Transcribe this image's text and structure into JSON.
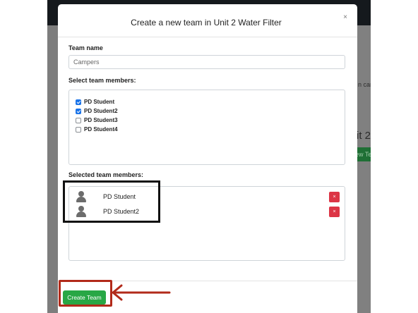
{
  "background": {
    "cards_text": "n card",
    "heading_text": "it 2",
    "new_team_button": "ew Te"
  },
  "modal": {
    "title": "Create a new team in Unit 2 Water Filter",
    "close_label": "×",
    "team_name_label": "Team name",
    "team_name_value": "Campers",
    "select_members_label": "Select team members:",
    "members": [
      {
        "name": "PD Student",
        "checked": true
      },
      {
        "name": "PD Student2",
        "checked": true
      },
      {
        "name": "PD Student3",
        "checked": false
      },
      {
        "name": "PD Student4",
        "checked": false
      }
    ],
    "selected_label": "Selected team members:",
    "selected_members": [
      {
        "name": "PD Student",
        "remove_label": "×"
      },
      {
        "name": "PD Student2",
        "remove_label": "×"
      }
    ],
    "create_button_label": "Create Team"
  },
  "colors": {
    "create_button": "#28a745",
    "remove_button": "#dc3545",
    "checkbox_checked": "#1a73e8",
    "annotation_red": "#b22a1a",
    "annotation_black": "#111111"
  },
  "icons": {
    "avatar": "person-icon",
    "close": "close-icon",
    "remove": "close-icon",
    "annotation": "arrow-left-icon"
  }
}
